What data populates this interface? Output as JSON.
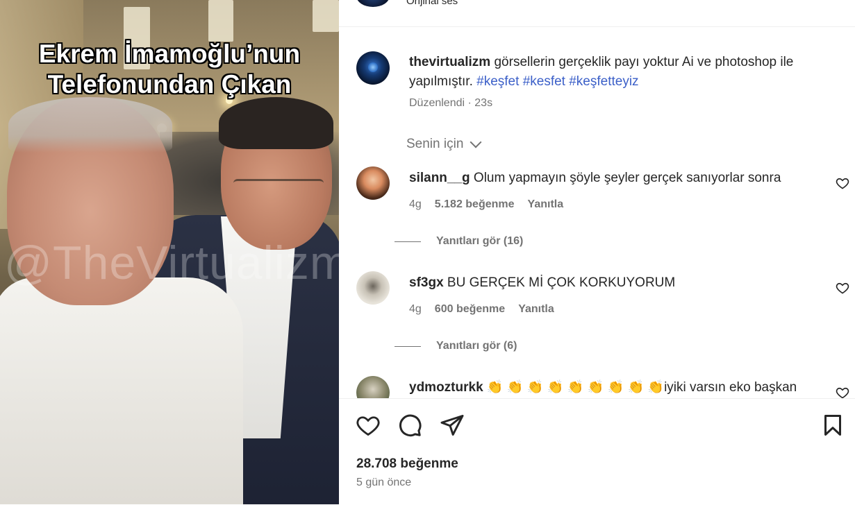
{
  "media": {
    "caption_lines": [
      "Ekrem İmamoğlu’nun",
      "Telefonundan Çıkan"
    ],
    "watermark": "@TheVirtualizm"
  },
  "top": {
    "audio_label": "Orijinal ses"
  },
  "post_caption": {
    "username": "thevirtualizm",
    "text": " görsellerin gerçeklik payı yoktur Ai ve photoshop ile yapılmıştır. ",
    "hashtags": [
      "#keşfet",
      "#kesfet",
      "#keşfetteyiz"
    ],
    "meta": "Düzenlendi · 23s"
  },
  "sort_label": "Senin için",
  "comments": [
    {
      "username": "silann__g",
      "text": " Olum yapmayın şöyle şeyler gerçek sanıyorlar sonra",
      "age": "4g",
      "likes": "5.182 beğenme",
      "reply_label": "Yanıtla",
      "view_replies": "Yanıtları gör (16)"
    },
    {
      "username": "sf3gx",
      "text": " BU GERÇEK Mİ ÇOK KORKUYORUM",
      "age": "4g",
      "likes": "600 beğenme",
      "reply_label": "Yanıtla",
      "view_replies": "Yanıtları gör (6)"
    },
    {
      "username": "ydmozturkk",
      "text": " 👏 👏 👏 👏 👏 👏 👏 👏 👏iyiki varsın eko başkan"
    }
  ],
  "footer": {
    "likes": "28.708 beğenme",
    "date": "5 gün önce"
  },
  "colors": {
    "hashtag": "#3b5fc8",
    "muted": "#737373",
    "text": "#262626"
  },
  "icons": [
    "heart-icon",
    "comment-icon",
    "share-icon",
    "bookmark-icon",
    "chevron-down-icon"
  ]
}
